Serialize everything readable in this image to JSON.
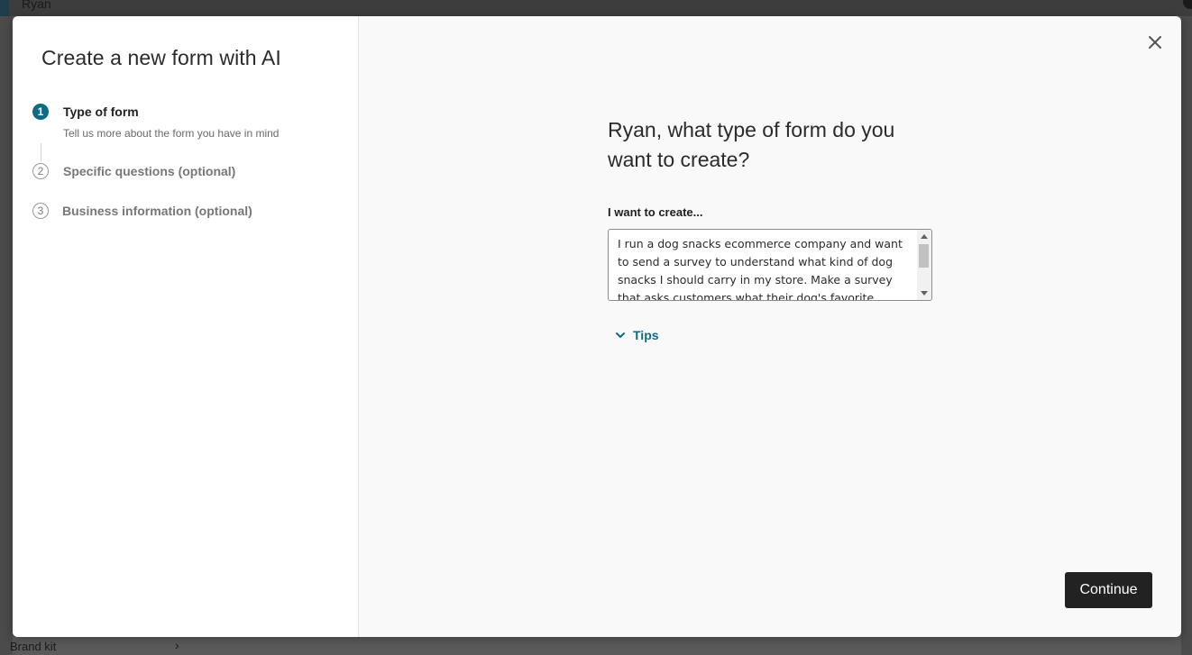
{
  "background": {
    "title": "Ryan",
    "brand_kit_label": "Brand kit"
  },
  "modal": {
    "title": "Create a new form with AI",
    "steps": [
      {
        "number": "1",
        "label": "Type of form",
        "description": "Tell us more about the form you have in mind",
        "state": "active"
      },
      {
        "number": "2",
        "label": "Specific questions (optional)",
        "state": "inactive"
      },
      {
        "number": "3",
        "label": "Business information (optional)",
        "state": "inactive"
      }
    ],
    "question": "Ryan, what type of form do you want to create?",
    "field_label": "I want to create...",
    "field_value": "I run a dog snacks ecommerce company and want to send a survey to understand what kind of dog snacks I should carry in my store. Make a survey that asks customers what their dog's favorite",
    "tips_label": "Tips",
    "continue_label": "Continue"
  },
  "icons": {
    "close": "close-icon",
    "tips": "chevron-down-icon",
    "brand_kit": "chevron-right-icon"
  },
  "colors": {
    "accent": "#0e6b86",
    "primary_button": "#222222"
  }
}
